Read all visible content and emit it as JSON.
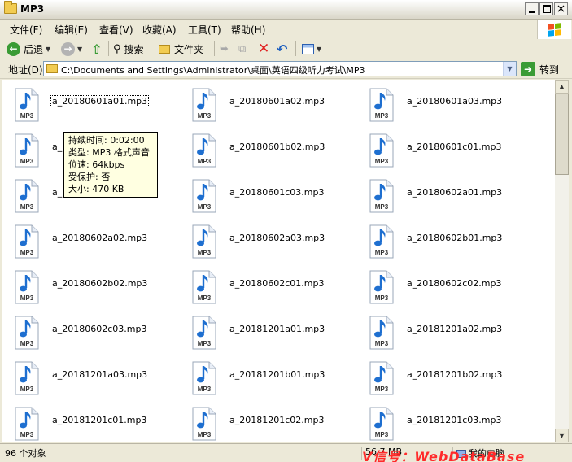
{
  "window": {
    "title": "MP3"
  },
  "menu": [
    "文件(F)",
    "编辑(E)",
    "查看(V)",
    "收藏(A)",
    "工具(T)",
    "帮助(H)"
  ],
  "toolbar": {
    "back": "后退",
    "search": "搜索",
    "folders": "文件夹"
  },
  "address": {
    "label": "地址(D)",
    "path": "C:\\Documents and Settings\\Administrator\\桌面\\英语四级听力考试\\MP3",
    "go": "转到"
  },
  "files": [
    "a_20180601a01.mp3",
    "a_20180601a02.mp3",
    "a_20180601a03.mp3",
    "a_20180601b01.mp3",
    "a_20180601b02.mp3",
    "a_20180601c01.mp3",
    "a_20180601c02.mp3",
    "a_20180601c03.mp3",
    "a_20180602a01.mp3",
    "a_20180602a02.mp3",
    "a_20180602a03.mp3",
    "a_20180602b01.mp3",
    "a_20180602b02.mp3",
    "a_20180602c01.mp3",
    "a_20180602c02.mp3",
    "a_20180602c03.mp3",
    "a_20181201a01.mp3",
    "a_20181201a02.mp3",
    "a_20181201a03.mp3",
    "a_20181201b01.mp3",
    "a_20181201b02.mp3",
    "a_20181201c01.mp3",
    "a_20181201c02.mp3",
    "a_20181201c03.mp3"
  ],
  "icon_label": "MP3",
  "tooltip": [
    "持续时间: 0:02:00",
    "类型: MP3 格式声音",
    "位速: 64kbps",
    "受保护: 否",
    "大小: 470 KB"
  ],
  "status": {
    "count": "96 个对象",
    "size": "56.7 MB",
    "computer": "我的电脑"
  },
  "watermark": "V信号：WebDataBase",
  "colors": {
    "icon_blue": "#1e6fd0",
    "tooltip_bg": "#ffffe1",
    "watermark": "#ff2a2a"
  }
}
